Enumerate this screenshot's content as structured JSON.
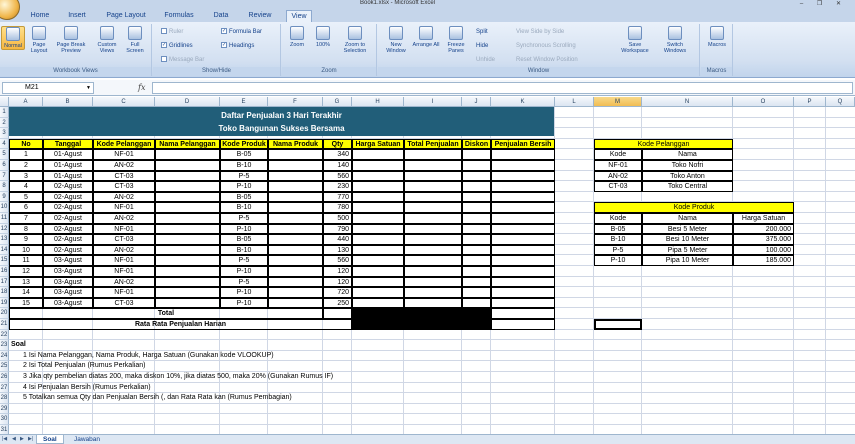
{
  "titlebar": {
    "title": "Book1.xlsx - Microsoft Excel",
    "controls": "‒ ❐ ✕"
  },
  "tabs": [
    "Home",
    "Insert",
    "Page Layout",
    "Formulas",
    "Data",
    "Review",
    "View"
  ],
  "ribbon": {
    "workbook_views": {
      "label": "Workbook Views",
      "buttons": [
        "Normal",
        "Page Layout",
        "Page Break Preview",
        "Custom Views",
        "Full Screen"
      ]
    },
    "show_hide": {
      "label": "Show/Hide",
      "ruler": "Ruler",
      "gridlines": "Gridlines",
      "message_bar": "Message Bar",
      "formula_bar": "Formula Bar",
      "headings": "Headings"
    },
    "zoom": {
      "label": "Zoom",
      "buttons": [
        "Zoom",
        "100%",
        "Zoom to Selection"
      ]
    },
    "window": {
      "label": "Window",
      "buttons": [
        "New Window",
        "Arrange All",
        "Freeze Panes"
      ],
      "split": "Split",
      "hide": "Hide",
      "unhide": "Unhide",
      "side_by_side": "View Side by Side",
      "sync_scroll": "Synchronous Scrolling",
      "reset_pos": "Reset Window Position",
      "save_ws": "Save Workspace",
      "switch": "Switch Windows"
    },
    "macros": {
      "label": "Macros",
      "button": "Macros"
    }
  },
  "formula_bar": {
    "name_box": "M21",
    "fx": "fx",
    "value": ""
  },
  "columns": [
    "A",
    "B",
    "C",
    "D",
    "E",
    "F",
    "G",
    "H",
    "I",
    "J",
    "K",
    "L",
    "M",
    "N",
    "O",
    "P",
    "Q"
  ],
  "sheet": {
    "title1": "Daftar Penjualan 3 Hari Terakhir",
    "title2": "Toko Bangunan Sukses Bersama",
    "headers": [
      "No",
      "Tanggal",
      "Kode Pelanggan",
      "Nama Pelanggan",
      "Kode Produk",
      "Nama Produk",
      "Qty",
      "Harga Satuan",
      "Total Penjualan",
      "Diskon",
      "Penjualan Bersih"
    ],
    "rows": [
      [
        "1",
        "01-Agust",
        "NF-01",
        "",
        "B-05",
        "",
        "340"
      ],
      [
        "2",
        "01-Agust",
        "AN-02",
        "",
        "B-10",
        "",
        "140"
      ],
      [
        "3",
        "01-Agust",
        "CT-03",
        "",
        "P-5",
        "",
        "560"
      ],
      [
        "4",
        "02-Agust",
        "CT-03",
        "",
        "P-10",
        "",
        "230"
      ],
      [
        "5",
        "02-Agust",
        "AN-02",
        "",
        "B-05",
        "",
        "770"
      ],
      [
        "6",
        "02-Agust",
        "NF-01",
        "",
        "B-10",
        "",
        "780"
      ],
      [
        "7",
        "02-Agust",
        "AN-02",
        "",
        "P-5",
        "",
        "500"
      ],
      [
        "8",
        "02-Agust",
        "NF-01",
        "",
        "P-10",
        "",
        "790"
      ],
      [
        "9",
        "02-Agust",
        "CT-03",
        "",
        "B-05",
        "",
        "440"
      ],
      [
        "10",
        "02-Agust",
        "AN-02",
        "",
        "B-10",
        "",
        "130"
      ],
      [
        "11",
        "03-Agust",
        "NF-01",
        "",
        "P-5",
        "",
        "560"
      ],
      [
        "12",
        "03-Agust",
        "NF-01",
        "",
        "P-10",
        "",
        "120"
      ],
      [
        "13",
        "03-Agust",
        "AN-02",
        "",
        "P-5",
        "",
        "120"
      ],
      [
        "14",
        "03-Agust",
        "NF-01",
        "",
        "P-10",
        "",
        "720"
      ],
      [
        "15",
        "03-Agust",
        "CT-03",
        "",
        "P-10",
        "",
        "250"
      ]
    ],
    "total_label": "Total",
    "avg_label": "Rata Rata Penjualan Harian",
    "pelanggan": {
      "title": "Kode Pelanggan",
      "headers": [
        "Kode",
        "Nama"
      ],
      "rows": [
        [
          "NF-01",
          "Toko Nofri"
        ],
        [
          "AN-02",
          "Toko Anton"
        ],
        [
          "CT-03",
          "Toko Central"
        ]
      ]
    },
    "produk": {
      "title": "Kode Produk",
      "headers": [
        "Kode",
        "Nama",
        "Harga Satuan"
      ],
      "rows": [
        [
          "B-05",
          "Besi 5 Meter",
          "200.000"
        ],
        [
          "B-10",
          "Besi 10 Meter",
          "375.000"
        ],
        [
          "P-5",
          "Pipa 5 Meter",
          "100.000"
        ],
        [
          "P-10",
          "Pipa 10 Meter",
          "185.000"
        ]
      ]
    },
    "soal_title": "Soal",
    "soal": [
      "1  Isi Nama Pelanggan, Nama Produk, Harga Satuan (Gunakan kode VLOOKUP)",
      "2  Isi Total Penjualan (Rumus Perkalian)",
      "3  Jika qty pembelian diatas 200, maka diskon 10%, jika diatas 500, maka 20% (Gunakan Rumus IF)",
      "4  Isi Penjualan Bersih (Rumus Perkalian)",
      "5  Totalkan semua Qty dan Penjualan Bersih (, dan Rata Rata kan (Rumus Pembagian)"
    ]
  },
  "sheet_tabs": [
    "Soal",
    "Jawaban"
  ]
}
